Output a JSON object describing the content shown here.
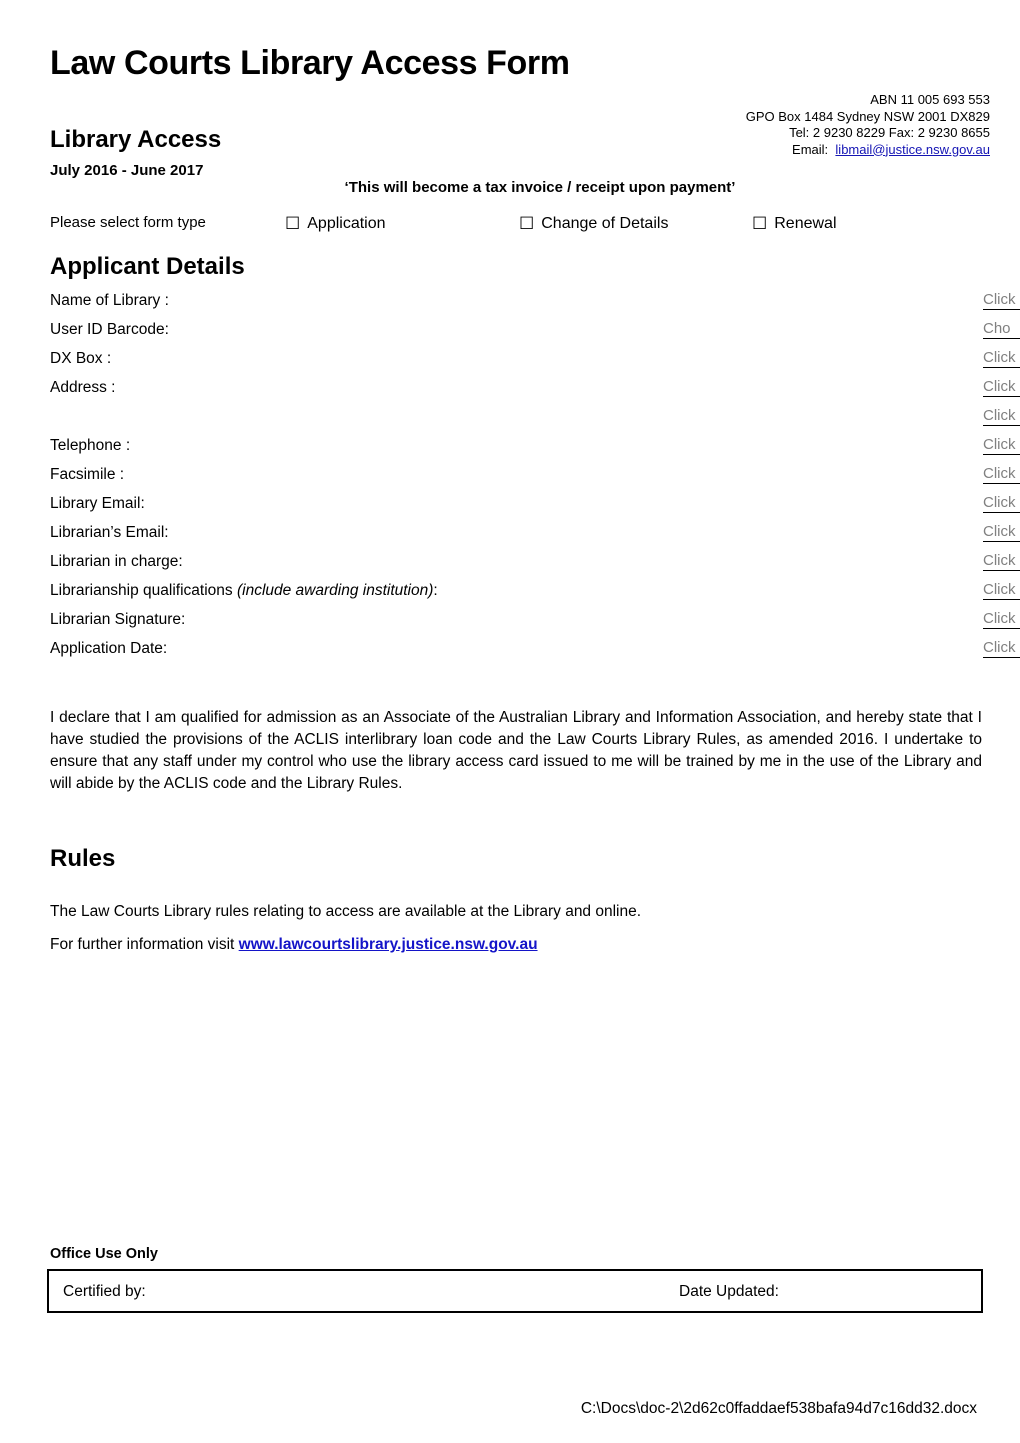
{
  "document": {
    "title": "Law Courts Library Access Form",
    "footer_path": "C:\\Docs\\doc-2\\2d62c0ffaddaef538bafa94d7c16dd32.docx"
  },
  "header": {
    "contact": {
      "abn": "ABN  11  005  693 553",
      "address": "GPO Box 1484 Sydney  NSW  2001  DX829",
      "phone_fax": "Tel: 2 9230 8229  Fax: 2 9230 8655",
      "email_label": "Email:",
      "email": "libmail@justice.nsw.gov.au"
    }
  },
  "library_access": {
    "heading": "Library Access",
    "date_range": "July 2016 - June 2017",
    "tax_note": "‘This will become a tax invoice / receipt upon payment’"
  },
  "form_type": {
    "label": "Please select form type",
    "checkbox_glyph": "☐",
    "options": [
      {
        "label": "Application",
        "checked": false
      },
      {
        "label": "Change of Details",
        "checked": false
      },
      {
        "label": "Renewal",
        "checked": false
      }
    ]
  },
  "applicant_details": {
    "heading": "Applicant Details",
    "fields": [
      {
        "label": "Name of Library :",
        "value": "Click",
        "type": "text"
      },
      {
        "label": "User ID Barcode:",
        "value": "Cho",
        "type": "dropdown"
      },
      {
        "label": "DX Box :",
        "value": "Click",
        "type": "text"
      },
      {
        "label": "Address :",
        "value": "Click",
        "type": "text"
      },
      {
        "label": "",
        "value": "Click",
        "type": "text"
      },
      {
        "label": "Telephone :",
        "value": "Click",
        "type": "text"
      },
      {
        "label": "Facsimile :",
        "value": "Click",
        "type": "text"
      },
      {
        "label": "Library Email:",
        "value": "Click",
        "type": "text"
      },
      {
        "label": "Librarian’s Email:",
        "value": "Click",
        "type": "text"
      },
      {
        "label": "Librarian in charge:",
        "value": "Click",
        "type": "text"
      },
      {
        "label": "Librarianship qualifications (include awarding institution):",
        "label_plain": "Librarianship qualifications ",
        "label_italic": "(include awarding institution)",
        "label_tail": ":",
        "value": "Click",
        "type": "text"
      },
      {
        "label": "Librarian Signature:",
        "value": "Click",
        "type": "text"
      },
      {
        "label": "Application Date:",
        "value": "Click",
        "type": "text"
      }
    ]
  },
  "declaration": {
    "text": "I declare that I am qualified for admission as an Associate of the Australian Library and Information Association, and hereby state that I have studied the provisions of the ACLIS interlibrary loan code and the Law Courts Library Rules, as amended 2016. I undertake to ensure that any staff under my control who use the library access card issued to me will be trained by me in the use of the Library and will abide by the ACLIS code and the Library Rules."
  },
  "rules": {
    "heading": "Rules",
    "line1": "The Law Courts Library rules relating to access are available at the Library and online.",
    "line2_prefix": "For further information visit ",
    "url": "www.lawcourtslibrary.justice.nsw.gov.au"
  },
  "office_use": {
    "heading": "Office Use Only",
    "certified_by_label": "Certified by:",
    "date_updated_label": "Date Updated:"
  }
}
